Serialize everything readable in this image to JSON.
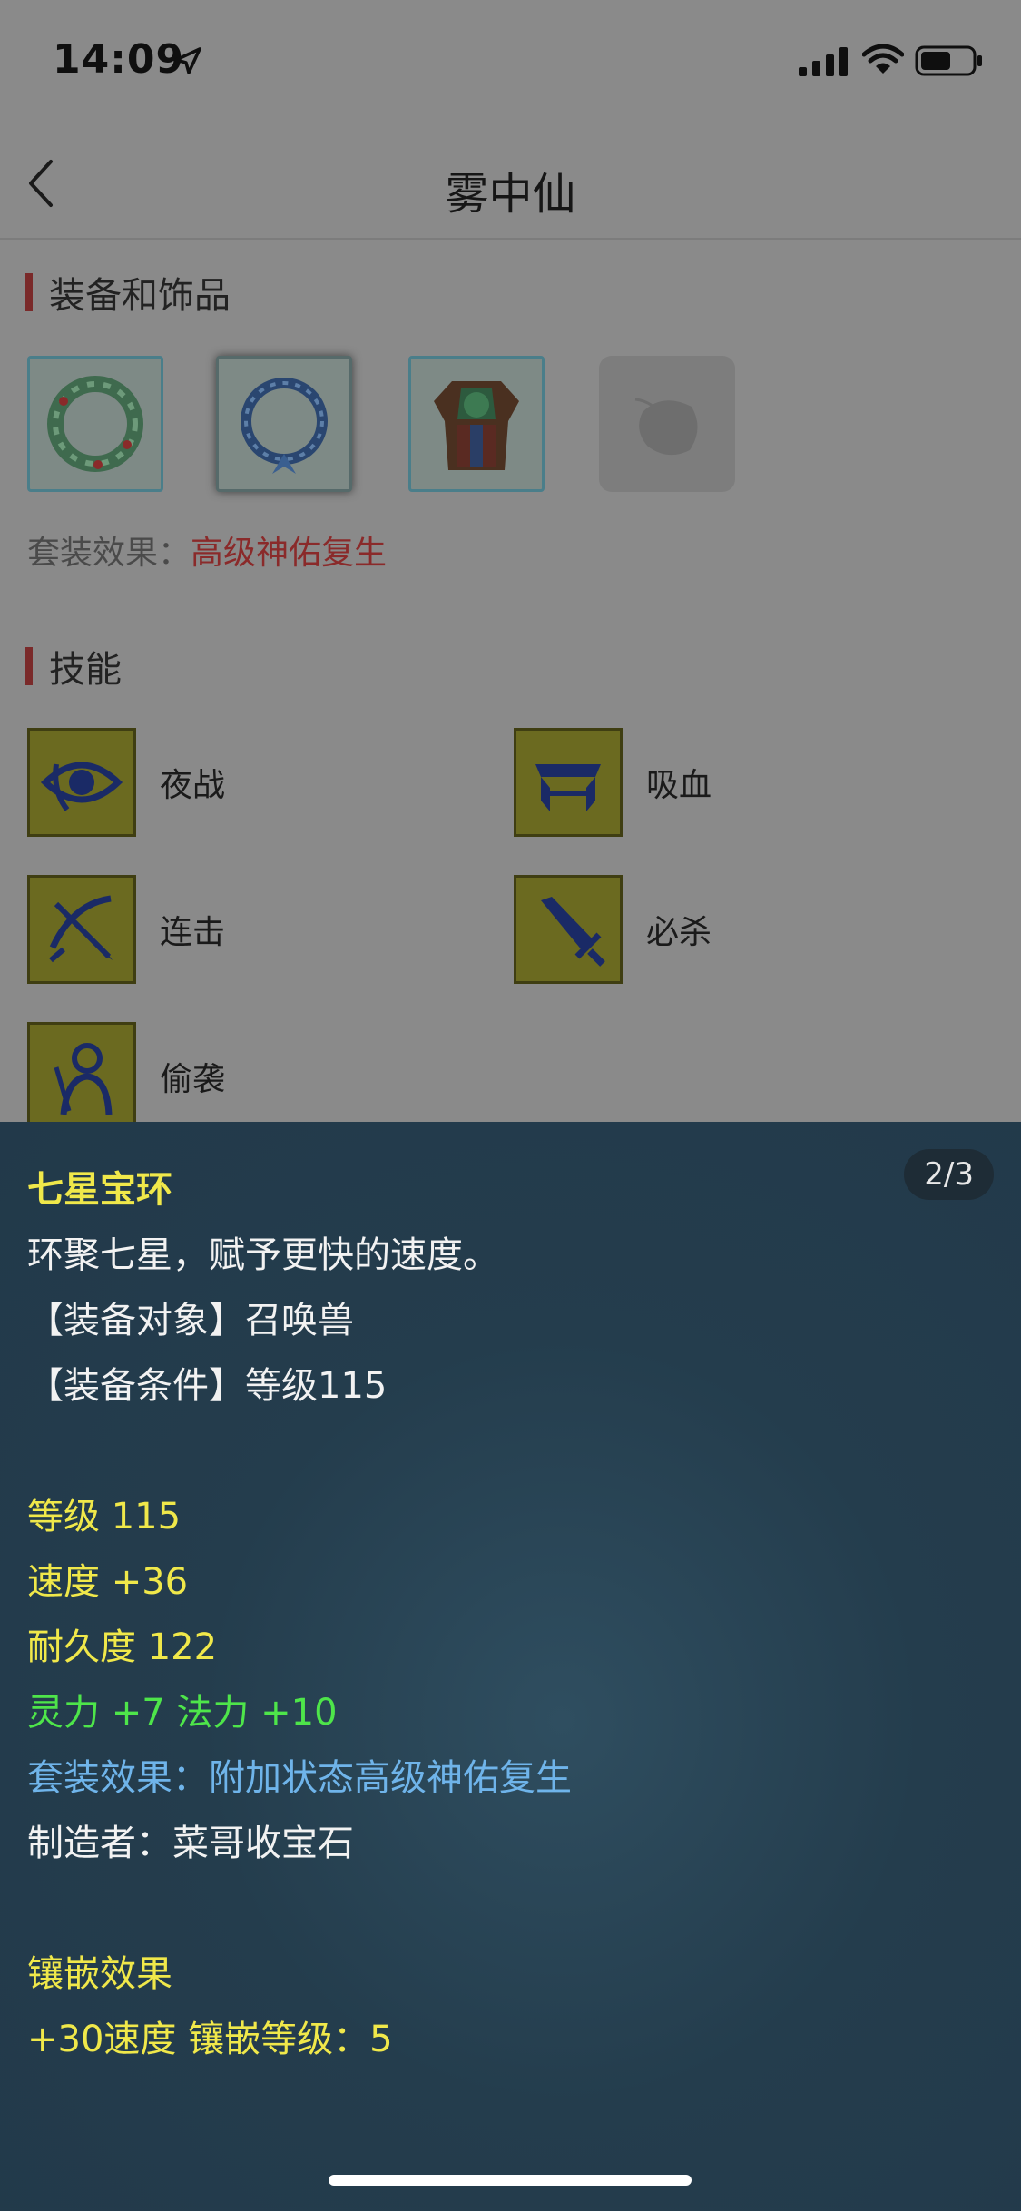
{
  "status_bar": {
    "time": "14:09",
    "icons": [
      "location-arrow-icon",
      "signal-icon",
      "wifi-icon",
      "battery-icon"
    ]
  },
  "nav": {
    "title": "雾中仙",
    "back_icon": "chevron-left-icon"
  },
  "equipment": {
    "section_title": "装备和饰品",
    "slots": [
      {
        "name": "green-ring",
        "state": "filled"
      },
      {
        "name": "blue-ring",
        "state": "selected"
      },
      {
        "name": "armor",
        "state": "filled"
      },
      {
        "name": "empty-slot",
        "state": "empty"
      }
    ],
    "set_label": "套装效果：",
    "set_value": "高级神佑复生"
  },
  "skills": {
    "section_title": "技能",
    "items": [
      {
        "label": "夜战",
        "icon": "eye-icon"
      },
      {
        "label": "吸血",
        "icon": "fangs-icon"
      },
      {
        "label": "连击",
        "icon": "crossbow-icon"
      },
      {
        "label": "必杀",
        "icon": "sword-icon"
      },
      {
        "label": "偷袭",
        "icon": "figure-icon"
      }
    ]
  },
  "tooltip": {
    "page_indicator": "2/3",
    "title": "七星宝环",
    "description": "环聚七星，赋予更快的速度。",
    "equip_target": "【装备对象】召唤兽",
    "equip_condition": "【装备条件】等级115",
    "level": "等级 115",
    "speed": "速度 +36",
    "durability": "耐久度 122",
    "bonus": "灵力 +7 法力 +10",
    "set_effect": "套装效果：附加状态高级神佑复生",
    "maker": "制造者：菜哥收宝石",
    "inlay_title": "镶嵌效果",
    "inlay_detail": "+30速度 镶嵌等级：5"
  },
  "colors": {
    "dim_background": "#8a8a8a",
    "tooltip_background": "#243d4d",
    "title_yellow": "#f0e84a",
    "bonus_green": "#4ee54a",
    "set_blue": "#6fb4ea",
    "set_red": "#8a2a2a"
  }
}
